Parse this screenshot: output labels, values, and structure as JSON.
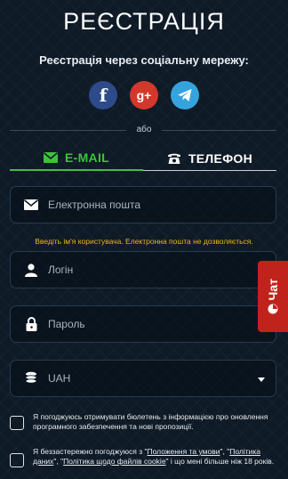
{
  "header": {
    "title": "РЕЄСТРАЦІЯ",
    "social_prompt": "Реєстрація через соціальну мережу:",
    "or_label": "або"
  },
  "socials": [
    {
      "icon": "facebook-icon",
      "glyph": "f",
      "color": "#2d4a8a"
    },
    {
      "icon": "google-plus-icon",
      "glyph": "g+",
      "color": "#d2382b"
    },
    {
      "icon": "telegram-icon",
      "glyph": "",
      "color": "#35a3dd"
    }
  ],
  "tabs": {
    "email": "E-MAIL",
    "phone": "ТЕЛЕФОН",
    "active": "email",
    "active_color": "#3ec23a"
  },
  "form": {
    "email_placeholder": "Електронна пошта",
    "email_error": "Введіть ім'я користувача. Електронна пошта не дозволяється.",
    "login_placeholder": "Логін",
    "password_placeholder": "Пароль",
    "currency_value": "UAH"
  },
  "consents": {
    "newsletter": "Я погоджуюсь отримувати бюлетень з інформацією про оновлення програмного забезпечення та нові пропозиції.",
    "terms_prefix": "Я беззастережно погоджуюся з \"",
    "terms_link": "Положення та умови",
    "terms_sep1": "\", \"",
    "privacy_link": "Політика даних",
    "terms_sep2": "\", \"",
    "cookie_link": "Політика щодо файлів cookie",
    "terms_suffix": "\" і що мені більше ніж 18 років."
  },
  "chat": {
    "label": "Чат",
    "color": "#c0231b"
  }
}
